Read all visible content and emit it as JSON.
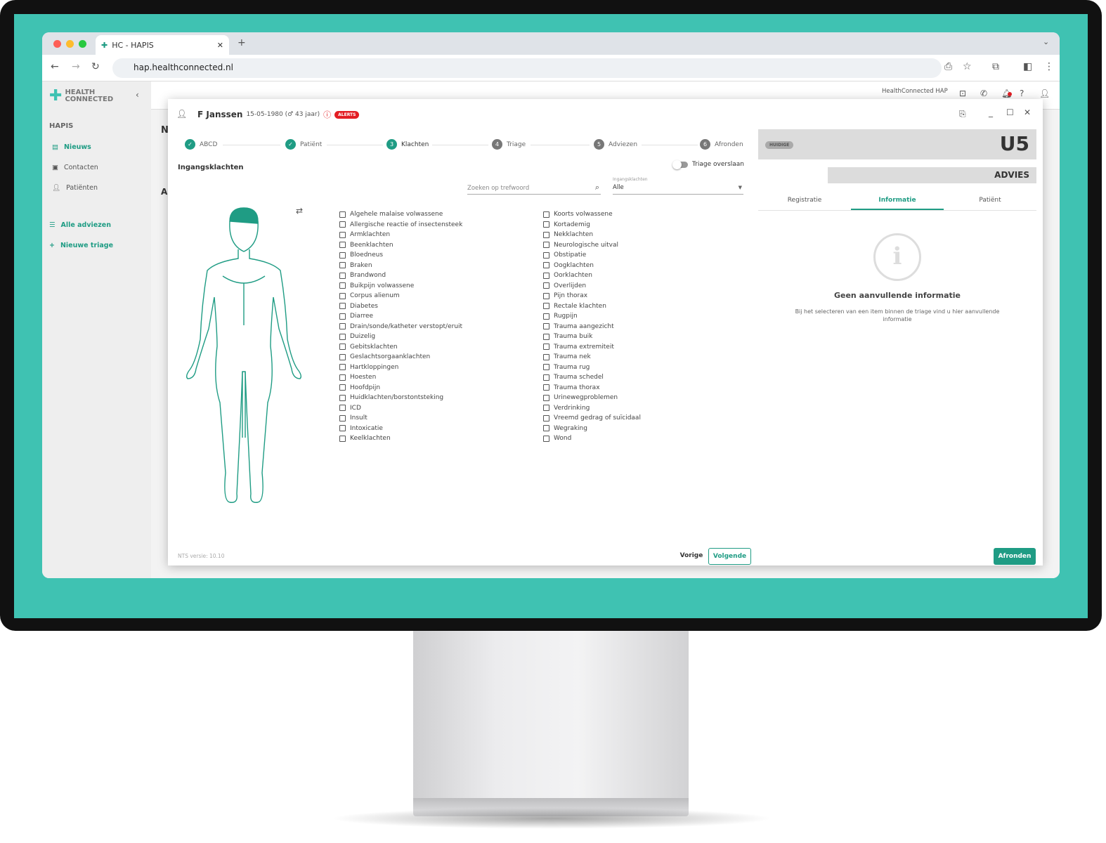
{
  "browser": {
    "tab_title": "HC - HAPIS",
    "url": "hap.healthconnected.nl"
  },
  "app": {
    "logo_line1": "HEALTH",
    "logo_line2": "CONNECTED",
    "section": "HAPIS",
    "org": "HealthConnected HAP",
    "sidebar": [
      {
        "label": "Nieuws",
        "icon": "newspaper-icon",
        "active": true
      },
      {
        "label": "Contacten",
        "icon": "contacts-icon"
      },
      {
        "label": "Patiënten",
        "icon": "person-icon"
      }
    ],
    "actions": [
      {
        "label": "Alle adviezen",
        "icon": "list-icon"
      },
      {
        "label": "Nieuwe triage",
        "icon": "plus-icon"
      }
    ],
    "bg_heading": "N",
    "bg_heading2": "Al"
  },
  "patient": {
    "name": "F Janssen",
    "details": "15-05-1980 (♂ 43 jaar)",
    "alert_badge": "ALERTS"
  },
  "steps": [
    {
      "n": "1",
      "label": "ABCD",
      "done": true
    },
    {
      "n": "2",
      "label": "Patiënt",
      "done": true
    },
    {
      "n": "3",
      "label": "Klachten",
      "current": true
    },
    {
      "n": "4",
      "label": "Triage"
    },
    {
      "n": "5",
      "label": "Adviezen"
    },
    {
      "n": "6",
      "label": "Afronden"
    }
  ],
  "complaints": {
    "title": "Ingangsklachten",
    "skip_toggle": "Triage overslaan",
    "skip_on": false,
    "search_placeholder": "Zoeken op trefwoord",
    "filter_label": "Ingangsklachten",
    "filter_value": "Alle",
    "col1": [
      "Algehele malaise volwassene",
      "Allergische reactie of insectensteek",
      "Armklachten",
      "Beenklachten",
      "Bloedneus",
      "Braken",
      "Brandwond",
      "Buikpijn volwassene",
      "Corpus alienum",
      "Diabetes",
      "Diarree",
      "Drain/sonde/katheter verstopt/eruit",
      "Duizelig",
      "Gebitsklachten",
      "Geslachtsorgaanklachten",
      "Hartkloppingen",
      "Hoesten",
      "Hoofdpijn",
      "Huidklachten/borstontsteking",
      "ICD",
      "Insult",
      "Intoxicatie",
      "Keelklachten"
    ],
    "col2": [
      "Koorts volwassene",
      "Kortademig",
      "Nekklachten",
      "Neurologische uitval",
      "Obstipatie",
      "Oogklachten",
      "Oorklachten",
      "Overlijden",
      "Pijn thorax",
      "Rectale klachten",
      "Rugpijn",
      "Trauma aangezicht",
      "Trauma buik",
      "Trauma extremiteit",
      "Trauma nek",
      "Trauma rug",
      "Trauma schedel",
      "Trauma thorax",
      "Urinewegproblemen",
      "Verdrinking",
      "Vreemd gedrag of suïcidaal",
      "Wegraking",
      "Wond"
    ]
  },
  "urgency": {
    "badge": "HUIDIGE",
    "code": "U5",
    "advice": "ADVIES"
  },
  "info_tabs": [
    {
      "label": "Registratie"
    },
    {
      "label": "Informatie",
      "active": true
    },
    {
      "label": "Patiënt"
    }
  ],
  "info": {
    "title": "Geen aanvullende informatie",
    "text": "Bij het selecteren van een item binnen de triage vind u hier aanvullende informatie"
  },
  "footer": {
    "version": "NTS versie: 10.10",
    "prev": "Vorige",
    "next": "Volgende",
    "finish": "Afronden"
  },
  "colors": {
    "accent": "#1f9c84",
    "alert": "#e31e24",
    "screen": "#3fc2b2"
  }
}
